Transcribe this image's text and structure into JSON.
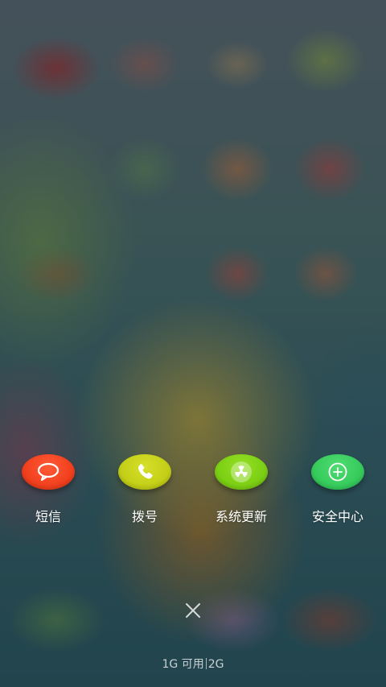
{
  "shortcuts": [
    {
      "label": "短信",
      "icon": "message-bubble-icon",
      "color": "#f33a1a"
    },
    {
      "label": "拨号",
      "icon": "phone-icon",
      "color": "#c5d10e"
    },
    {
      "label": "系统更新",
      "icon": "radiation-icon",
      "color": "#7ed10e"
    },
    {
      "label": "安全中心",
      "icon": "plus-circle-icon",
      "color": "#36cc5c"
    }
  ],
  "close_icon": "close-icon",
  "memory": {
    "available": "1G 可用",
    "total": "2G"
  }
}
